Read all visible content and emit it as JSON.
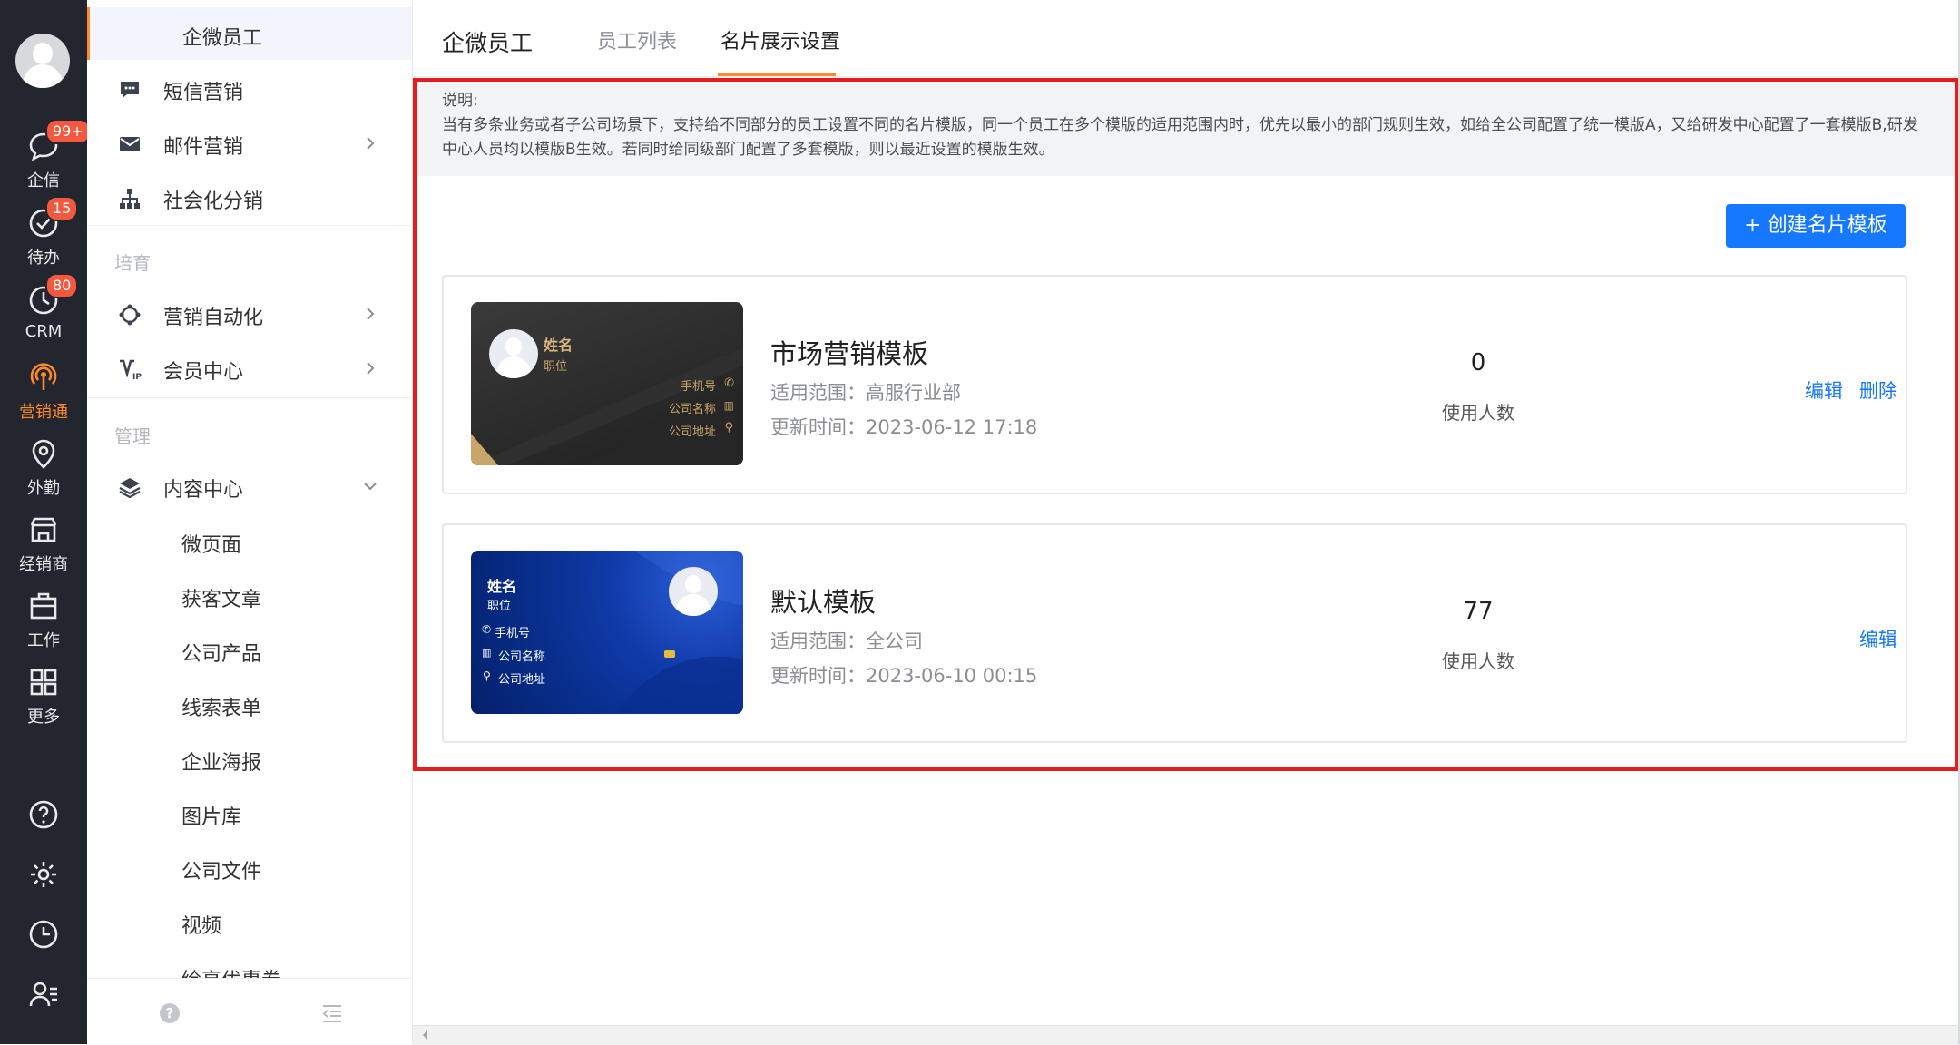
{
  "rail": {
    "items": [
      {
        "label": "企信",
        "icon": "chat-icon",
        "badge": "99+"
      },
      {
        "label": "待办",
        "icon": "check-circle-icon",
        "badge": "15"
      },
      {
        "label": "CRM",
        "icon": "clock-icon",
        "badge": "80"
      },
      {
        "label": "营销通",
        "icon": "broadcast-icon",
        "active": true
      },
      {
        "label": "外勤",
        "icon": "location-pin-icon"
      },
      {
        "label": "经销商",
        "icon": "store-icon"
      },
      {
        "label": "工作",
        "icon": "briefcase-icon"
      },
      {
        "label": "更多",
        "icon": "grid-icon"
      }
    ],
    "bottom_icons": [
      "help-icon",
      "settings-icon",
      "history-icon",
      "user-list-icon"
    ],
    "accent": "#ff8a2b",
    "background": "#23262e"
  },
  "sidebar": {
    "current": "企微员工",
    "items": {
      "sms": "短信营销",
      "email": "邮件营销",
      "social": "社会化分销",
      "group_nurture": "培育",
      "automation": "营销自动化",
      "member": "会员中心",
      "group_manage": "管理",
      "content": "内容中心",
      "sub": [
        "微页面",
        "获客文章",
        "公司产品",
        "线索表单",
        "企业海报",
        "图片库",
        "公司文件",
        "视频",
        "绘享优惠券"
      ]
    }
  },
  "tabs": {
    "title": "企微员工",
    "items": [
      "员工列表",
      "名片展示设置"
    ],
    "active": "名片展示设置"
  },
  "notice": {
    "label": "说明:",
    "text": "当有多条业务或者子公司场景下，支持给不同部分的员工设置不同的名片模版，同一个员工在多个模版的适用范围内时，优先以最小的部门规则生效，如给全公司配置了统一模版A，又给研发中心配置了一套模版B,研发中心人员均以模版B生效。若同时给同级部门配置了多套模版，则以最近设置的模版生效。"
  },
  "create_button": "+ 创建名片模板",
  "templates": [
    {
      "name": "市场营销模板",
      "scope": "适用范围：高服行业部",
      "updated": "更新时间：2023-06-12 17:18",
      "count": "0",
      "count_label": "使用人数",
      "card": {
        "name": "姓名",
        "position": "职位",
        "phone": "手机号",
        "company": "公司名称",
        "address": "公司地址"
      },
      "actions": {
        "edit": "编辑",
        "delete": "删除"
      }
    },
    {
      "name": "默认模板",
      "scope": "适用范围：全公司",
      "updated": "更新时间：2023-06-10 00:15",
      "count": "77",
      "count_label": "使用人数",
      "card": {
        "name": "姓名",
        "position": "职位",
        "phone": "手机号",
        "company": "公司名称",
        "address": "公司地址"
      },
      "actions": {
        "edit": "编辑"
      }
    }
  ]
}
